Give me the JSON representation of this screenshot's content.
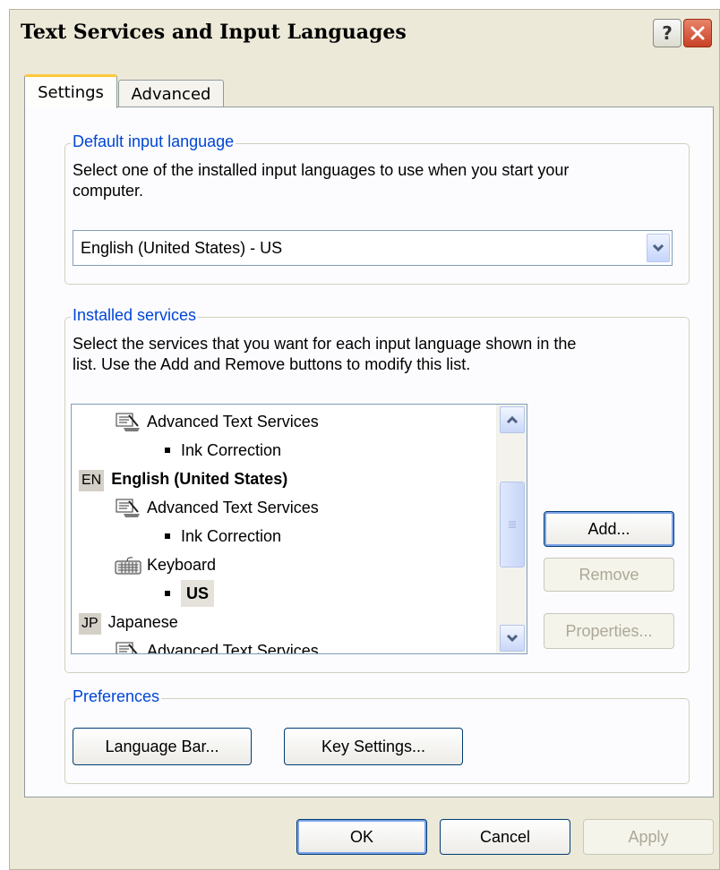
{
  "window": {
    "title": "Text Services and Input Languages",
    "help_glyph": "?",
    "close_glyph": "✕"
  },
  "tabs": [
    {
      "label": "Settings",
      "active": true
    },
    {
      "label": "Advanced",
      "active": false
    }
  ],
  "default_input_language": {
    "legend": "Default input language",
    "description_line1": "Select one of the installed input languages to use when you start your",
    "description_line2": "computer.",
    "selected_value": "English (United States) - US"
  },
  "installed_services": {
    "legend": "Installed services",
    "description_line1": "Select the services that you want for each input language shown in the",
    "description_line2": "list. Use the Add and Remove buttons to modify this list.",
    "items": [
      {
        "label": "Advanced Text Services",
        "kind": "service",
        "icon": "text-services-icon"
      },
      {
        "label": "Ink Correction",
        "kind": "bullet"
      },
      {
        "label": "English (United States)",
        "kind": "language",
        "badge": "EN"
      },
      {
        "label": "Advanced Text Services",
        "kind": "service",
        "icon": "text-services-icon"
      },
      {
        "label": "Ink Correction",
        "kind": "bullet"
      },
      {
        "label": "Keyboard",
        "kind": "service",
        "icon": "keyboard-icon"
      },
      {
        "label": "US",
        "kind": "bullet",
        "selected": true
      },
      {
        "label": "Japanese",
        "kind": "language",
        "badge": "JP"
      },
      {
        "label": "Advanced Text Services",
        "kind": "service",
        "icon": "text-services-icon",
        "partially_visible": true
      }
    ],
    "buttons": {
      "add": "Add...",
      "remove": "Remove",
      "properties": "Properties..."
    }
  },
  "preferences": {
    "legend": "Preferences",
    "language_bar": "Language Bar...",
    "key_settings": "Key Settings..."
  },
  "footer": {
    "ok": "OK",
    "cancel": "Cancel",
    "apply": "Apply"
  },
  "colors": {
    "group_legend": "#0046d5",
    "dialog_bg": "#ece9d8",
    "active_tab_accent": "#ffc83c",
    "close_button": "#c84226"
  }
}
